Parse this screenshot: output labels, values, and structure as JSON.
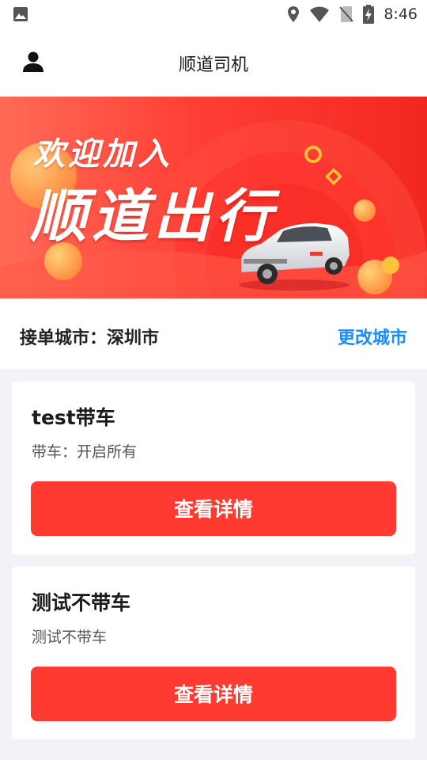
{
  "status_bar": {
    "time": "8:46",
    "icons": [
      "image-icon",
      "location-icon",
      "wifi-icon",
      "no-sim-icon",
      "battery-charging-icon"
    ]
  },
  "header": {
    "title": "顺道司机",
    "user_icon": "user-icon"
  },
  "banner": {
    "welcome_text": "欢迎加入",
    "brand_text": "顺道出行",
    "colors": {
      "primary": "#ff3f36",
      "light": "#ff6b57",
      "accent": "#ffb33a"
    }
  },
  "city": {
    "label": "接单城市：深圳市",
    "change_label": "更改城市",
    "change_color": "#1a8cff"
  },
  "cards": [
    {
      "title": "test带车",
      "desc": "带车：开启所有",
      "button": "查看详情"
    },
    {
      "title": "测试不带车",
      "desc": "测试不带车",
      "button": "查看详情"
    }
  ],
  "accent_color": "#ff3a30"
}
